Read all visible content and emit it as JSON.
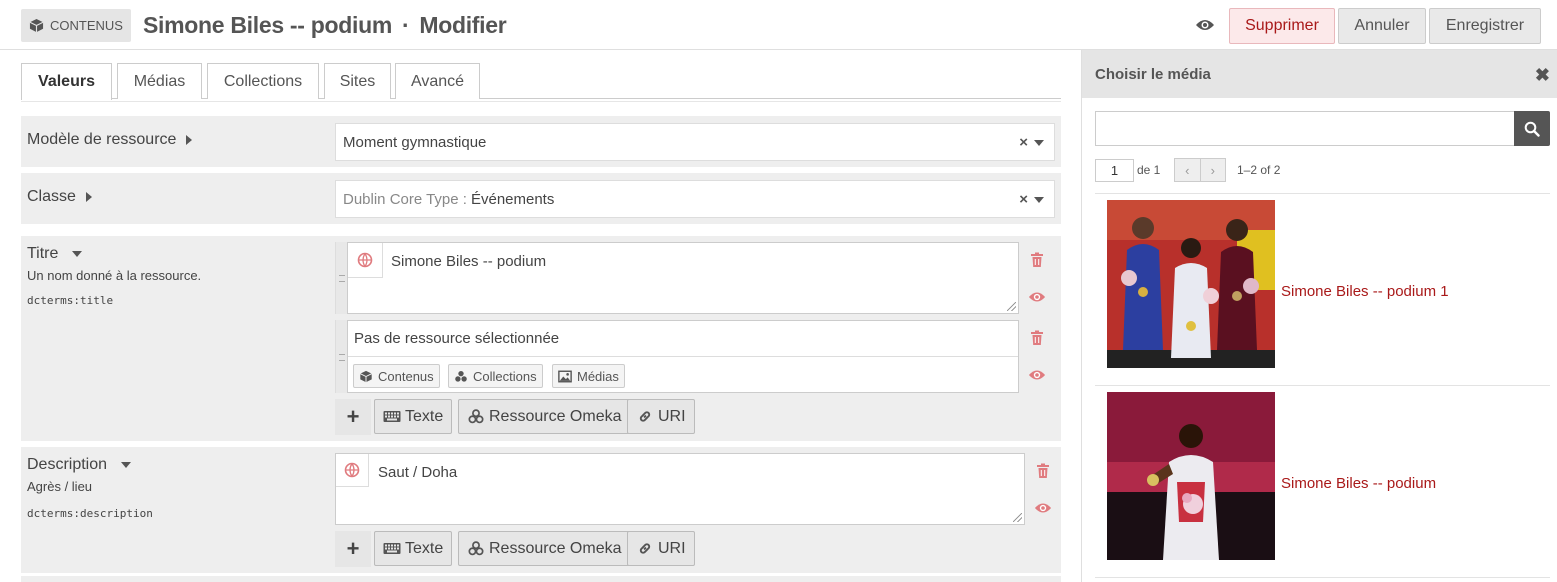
{
  "header": {
    "breadcrumb": "CONTENUS",
    "item_title": "Simone Biles -- podium",
    "separator": "·",
    "action": "Modifier",
    "delete_label": "Supprimer",
    "cancel_label": "Annuler",
    "save_label": "Enregistrer"
  },
  "tabs": [
    "Valeurs",
    "Médias",
    "Collections",
    "Sites",
    "Avancé"
  ],
  "form": {
    "template": {
      "label": "Modèle de ressource",
      "value": "Moment gymnastique"
    },
    "class": {
      "label": "Classe",
      "prefix": "Dublin Core Type :",
      "value": "Événements"
    },
    "title": {
      "label": "Titre",
      "comment": "Un nom donné à la ressource.",
      "term": "dcterms:title",
      "literal_value": "Simone Biles -- podium",
      "resource_placeholder": "Pas de ressource sélectionnée",
      "resource_buttons": [
        "Contenus",
        "Collections",
        "Médias"
      ]
    },
    "description": {
      "label": "Description",
      "comment": "Agrès / lieu",
      "term": "dcterms:description",
      "literal_value": "Saut / Doha"
    },
    "add_buttons": {
      "plus": "+",
      "text": "Texte",
      "resource": "Ressource Omeka",
      "uri": "URI"
    }
  },
  "sidebar": {
    "title": "Choisir le média",
    "close": "✖",
    "search_value": "",
    "page": "1",
    "page_of": "de 1",
    "range": "1–2 of 2",
    "media": [
      {
        "title": "Simone Biles -- podium 1"
      },
      {
        "title": "Simone Biles -- podium"
      }
    ]
  },
  "colors": {
    "accent": "#a91919",
    "panel": "#eeeeee",
    "icon_red": "#e07b7f"
  }
}
